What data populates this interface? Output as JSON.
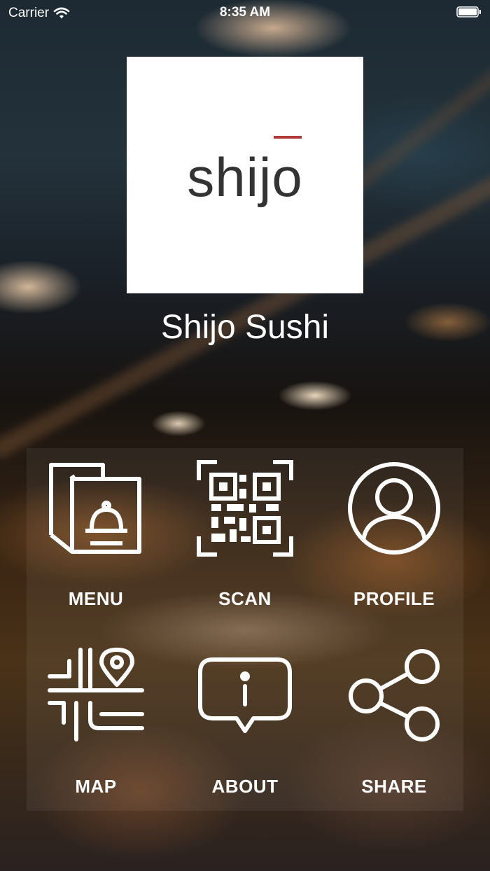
{
  "status_bar": {
    "carrier": "Carrier",
    "time": "8:35 AM"
  },
  "logo": {
    "wordmark": "shijo",
    "accent_color": "#b03a3a"
  },
  "restaurant": {
    "name": "Shijo Sushi"
  },
  "menu_items": [
    {
      "label": "MENU",
      "icon": "menu-cloche-icon"
    },
    {
      "label": "SCAN",
      "icon": "qr-code-icon"
    },
    {
      "label": "PROFILE",
      "icon": "user-profile-icon"
    },
    {
      "label": "MAP",
      "icon": "map-pin-icon"
    },
    {
      "label": "ABOUT",
      "icon": "info-bubble-icon"
    },
    {
      "label": "SHARE",
      "icon": "share-icon"
    }
  ]
}
